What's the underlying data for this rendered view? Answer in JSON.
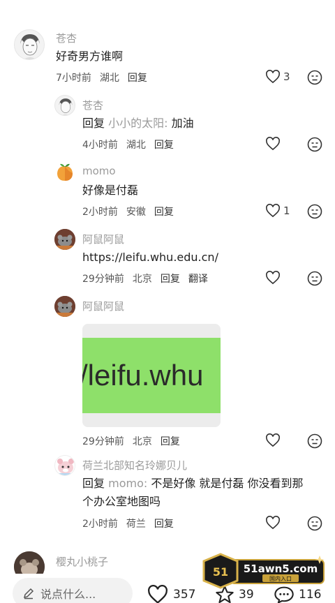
{
  "comments": [
    {
      "user": "苍杏",
      "text": "好奇男方谁啊",
      "time": "7小时前",
      "location": "湖北",
      "reply_label": "回复",
      "likes": "3"
    }
  ],
  "replies": [
    {
      "user": "苍杏",
      "prefix": "回复",
      "mention": "小小的太阳:",
      "text": " 加油",
      "time": "4小时前",
      "location": "湖北",
      "reply_label": "回复",
      "likes": ""
    },
    {
      "user": "momo",
      "text": "好像是付磊",
      "time": "2小时前",
      "location": "安徽",
      "reply_label": "回复",
      "likes": "1"
    },
    {
      "user": "阿鼠阿鼠",
      "text": "https://leifu.whu.edu.cn/",
      "time": "29分钟前",
      "location": "北京",
      "reply_label": "回复",
      "translate_label": "翻译",
      "likes": ""
    },
    {
      "user": "阿鼠阿鼠",
      "image_text": "/leifu.whu",
      "time": "29分钟前",
      "location": "北京",
      "reply_label": "回复",
      "likes": ""
    },
    {
      "user": "荷兰北部知名玲娜贝儿",
      "prefix": "回复",
      "mention": "momo:",
      "text_line1": " 不是好像 就是付磊 你没看到那",
      "text_line2": "个办公室地图吗",
      "time": "2小时前",
      "location": "荷兰",
      "reply_label": "回复",
      "likes": ""
    }
  ],
  "next_comment": {
    "user": "樱丸小桃子"
  },
  "bottom_bar": {
    "input_placeholder": "说点什么...",
    "likes": "357",
    "favorites": "39",
    "comments": "116"
  },
  "watermark": {
    "site": "51awn5.com",
    "sub": "国内入口",
    "logo": "51"
  },
  "colors": {
    "username": "#9a9a9a",
    "image_bg": "#8ee06a",
    "text": "#222222"
  }
}
